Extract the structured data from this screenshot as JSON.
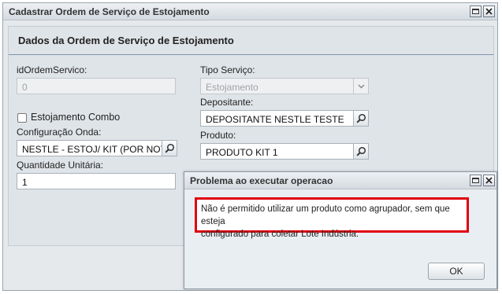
{
  "main_window": {
    "title": "Cadastrar Ordem de Serviço de Estojamento",
    "section_title": "Dados da Ordem de Serviço de Estojamento",
    "fields": {
      "id_label": "idOrdemServico:",
      "id_value": "0",
      "combo_label": "Estojamento Combo",
      "combo_checked": false,
      "config_label": "Configuração Onda:",
      "config_value": "NESTLE - ESTOJ/ KIT (POR NOTA",
      "qty_label": "Quantidade Unitária:",
      "qty_value": "1",
      "tipo_label": "Tipo Serviço:",
      "tipo_value": "Estojamento",
      "depositante_label": "Depositante:",
      "depositante_value": "DEPOSITANTE NESTLE TESTE",
      "produto_label": "Produto:",
      "produto_value": "PRODUTO KIT 1"
    }
  },
  "dialog": {
    "title": "Problema ao executar operacao",
    "message_line1": "Não é permitido utilizar um produto como agrupador, sem que esteja",
    "message_line2": "configurado para coletar Lote Indústria.",
    "ok_label": "OK"
  },
  "colors": {
    "error_border": "#e0000f",
    "section_rule": "#7d94b0"
  }
}
